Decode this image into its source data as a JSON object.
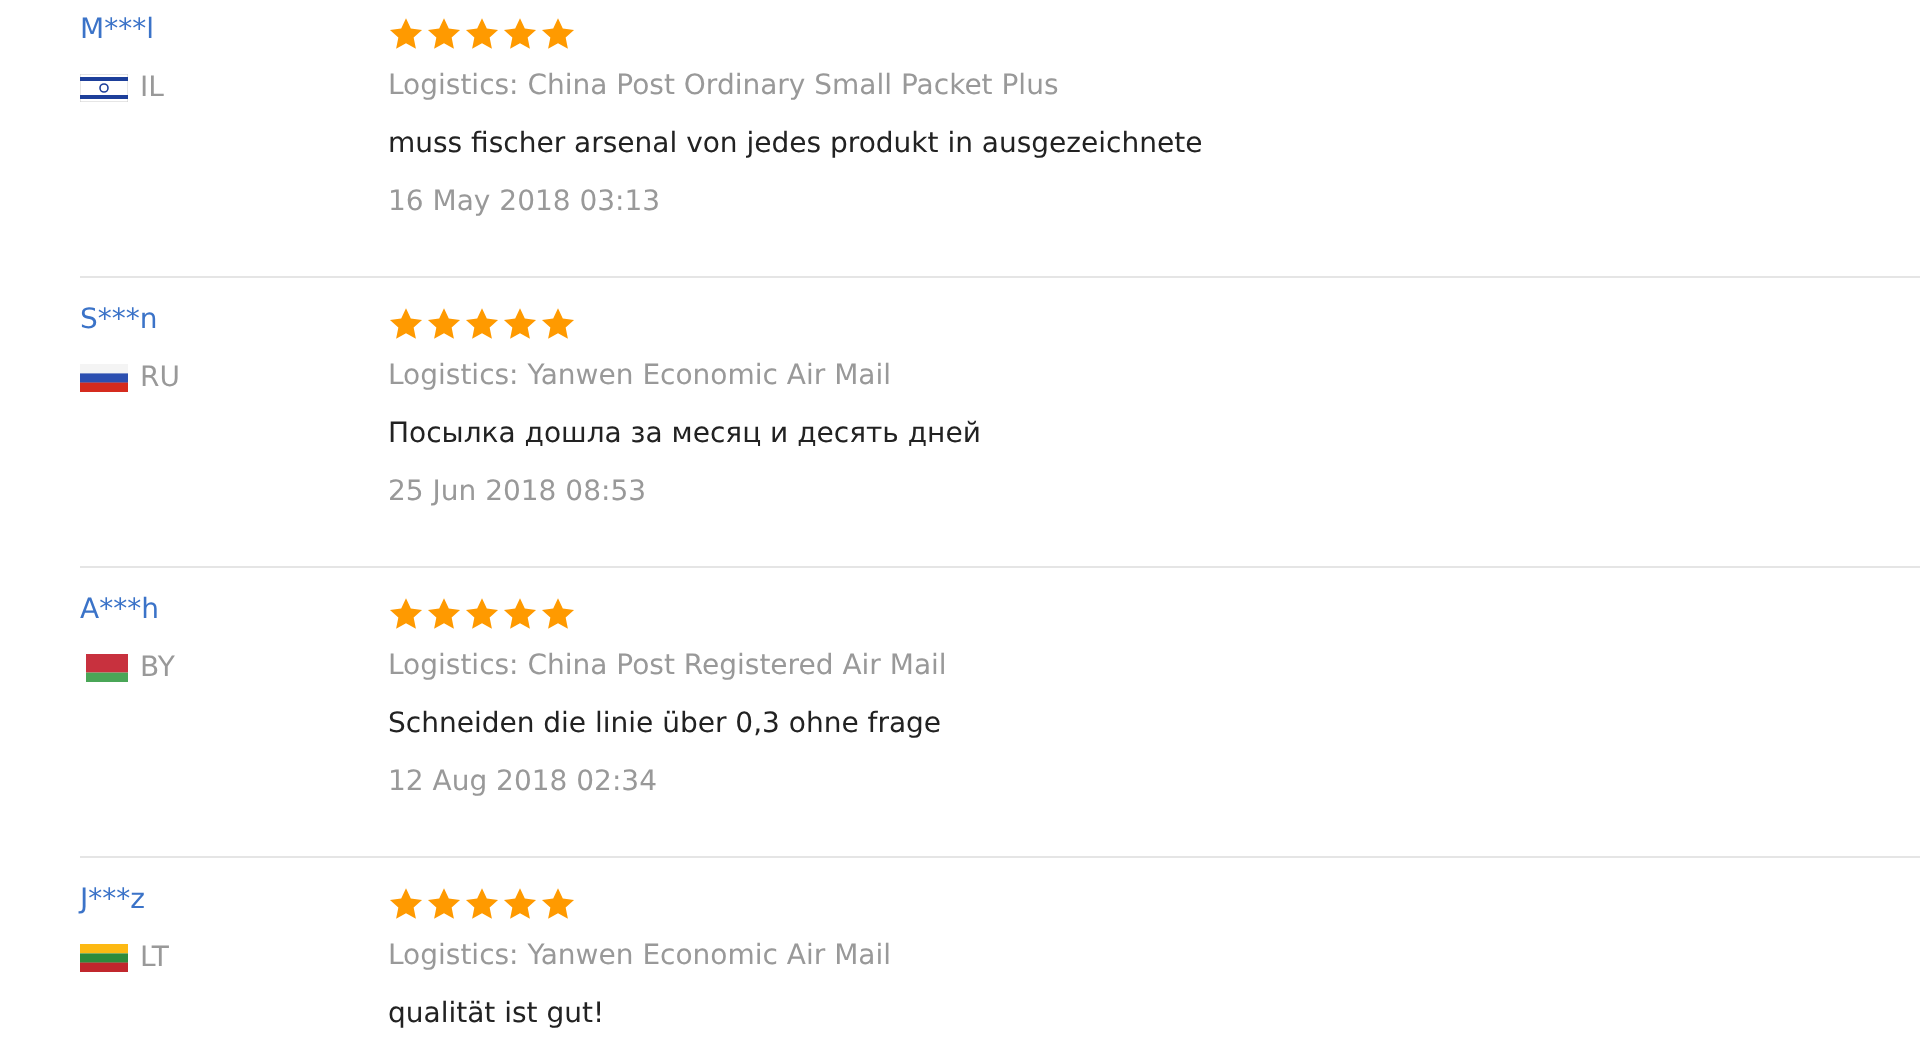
{
  "reviews": [
    {
      "name": "M***l",
      "flag": {
        "kind": "israel"
      },
      "country": "IL",
      "stars": 5,
      "logistics": "Logistics: China Post Ordinary Small Packet Plus",
      "comment": "muss fischer arsenal von jedes produkt in ausgezeichnete",
      "date": "16 May 2018 03:13"
    },
    {
      "name": "S***n",
      "flag": {
        "kind": "russia"
      },
      "country": "RU",
      "stars": 5,
      "logistics": "Logistics: Yanwen Economic Air Mail",
      "comment": "Посылка дошла за месяц и десять дней",
      "date": "25 Jun 2018 08:53"
    },
    {
      "name": "A***h",
      "flag": {
        "kind": "belarus"
      },
      "country": "BY",
      "stars": 5,
      "logistics": "Logistics: China Post Registered Air Mail",
      "comment": "Schneiden die linie über 0,3 ohne frage",
      "date": "12 Aug 2018 02:34"
    },
    {
      "name": "J***z",
      "flag": {
        "kind": "lithuania"
      },
      "country": "LT",
      "stars": 5,
      "logistics": "Logistics: Yanwen Economic Air Mail",
      "comment": "qualität ist gut!"
    }
  ]
}
